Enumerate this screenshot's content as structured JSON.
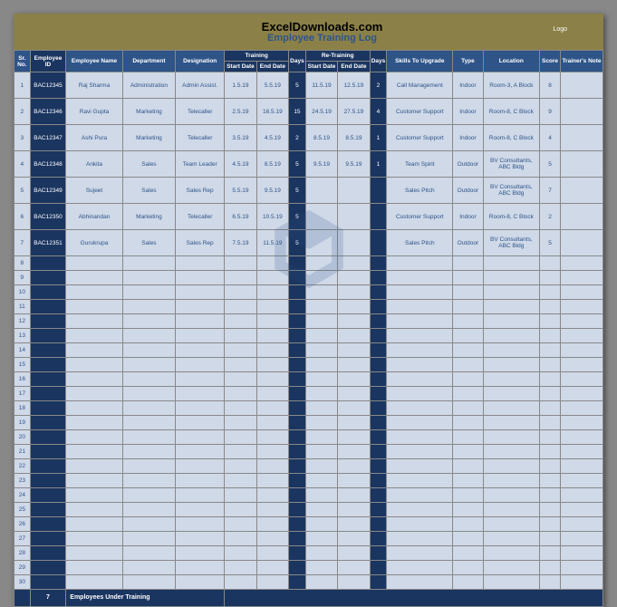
{
  "brand": "ExcelDownloads.com",
  "subtitle": "Employee Training Log",
  "logo": "Logo",
  "headers": {
    "sr": "Sr. No.",
    "eid": "Employee ID",
    "enm": "Employee Name",
    "dep": "Department",
    "des": "Designation",
    "trg": "Training",
    "sd": "Start Date",
    "ed": "End Date",
    "dy": "Days",
    "rtrg": "Re-Training",
    "sk": "Skills To Upgrade",
    "tp": "Type",
    "lc": "Location",
    "sc": "Score",
    "tn": "Trainer's Note"
  },
  "rows": [
    {
      "sr": "1",
      "eid": "BAC12345",
      "enm": "Raj Sharma",
      "dep": "Administration",
      "des": "Admin Assist.",
      "sd": "1.5.19",
      "ed": "5.5.19",
      "dy": "5",
      "rsd": "11.5.19",
      "red": "12.5.19",
      "rdy": "2",
      "sk": "Call Management",
      "tp": "Indoor",
      "lc": "Room-3, A Block",
      "sc": "8",
      "tn": ""
    },
    {
      "sr": "2",
      "eid": "BAC12346",
      "enm": "Ravi Gupta",
      "dep": "Marketing",
      "des": "Telecaller",
      "sd": "2.5.19",
      "ed": "16.5.19",
      "dy": "15",
      "rsd": "24.5.19",
      "red": "27.5.19",
      "rdy": "4",
      "sk": "Customer Support",
      "tp": "Indoor",
      "lc": "Room-8, C Block",
      "sc": "9",
      "tn": ""
    },
    {
      "sr": "3",
      "eid": "BAC12347",
      "enm": "Ashi Pura",
      "dep": "Marketing",
      "des": "Telecaller",
      "sd": "3.5.19",
      "ed": "4.5.19",
      "dy": "2",
      "rsd": "8.5.19",
      "red": "8.5.19",
      "rdy": "1",
      "sk": "Customer Support",
      "tp": "Indoor",
      "lc": "Room-8, C Block",
      "sc": "4",
      "tn": ""
    },
    {
      "sr": "4",
      "eid": "BAC12348",
      "enm": "Ankita",
      "dep": "Sales",
      "des": "Team Leader",
      "sd": "4.5.19",
      "ed": "8.5.19",
      "dy": "5",
      "rsd": "9.5.19",
      "red": "9.5.19",
      "rdy": "1",
      "sk": "Team Spirit",
      "tp": "Outdoor",
      "lc": "BV Consultants, ABC Bldg",
      "sc": "5",
      "tn": ""
    },
    {
      "sr": "5",
      "eid": "BAC12349",
      "enm": "Sujeet",
      "dep": "Sales",
      "des": "Sales Rep",
      "sd": "5.5.19",
      "ed": "9.5.19",
      "dy": "5",
      "rsd": "",
      "red": "",
      "rdy": "",
      "sk": "Sales Pitch",
      "tp": "Outdoor",
      "lc": "BV Consultants, ABC Bldg",
      "sc": "7",
      "tn": ""
    },
    {
      "sr": "6",
      "eid": "BAC12350",
      "enm": "Abhinandan",
      "dep": "Marketing",
      "des": "Telecaller",
      "sd": "6.5.19",
      "ed": "10.5.19",
      "dy": "5",
      "rsd": "",
      "red": "",
      "rdy": "",
      "sk": "Customer Support",
      "tp": "Indoor",
      "lc": "Room-8, C Block",
      "sc": "2",
      "tn": ""
    },
    {
      "sr": "7",
      "eid": "BAC12351",
      "enm": "Gurukrupa",
      "dep": "Sales",
      "des": "Sales Rep",
      "sd": "7.5.19",
      "ed": "11.5.19",
      "dy": "5",
      "rsd": "",
      "red": "",
      "rdy": "",
      "sk": "Sales Pitch",
      "tp": "Outdoor",
      "lc": "BV Consultants, ABC Bldg",
      "sc": "5",
      "tn": ""
    }
  ],
  "emptyRows": [
    "8",
    "9",
    "10",
    "11",
    "12",
    "13",
    "14",
    "15",
    "16",
    "17",
    "18",
    "19",
    "20",
    "21",
    "22",
    "23",
    "24",
    "25",
    "26",
    "27",
    "28",
    "29",
    "30"
  ],
  "footer": {
    "count": "7",
    "label": "Employees Under Training"
  }
}
